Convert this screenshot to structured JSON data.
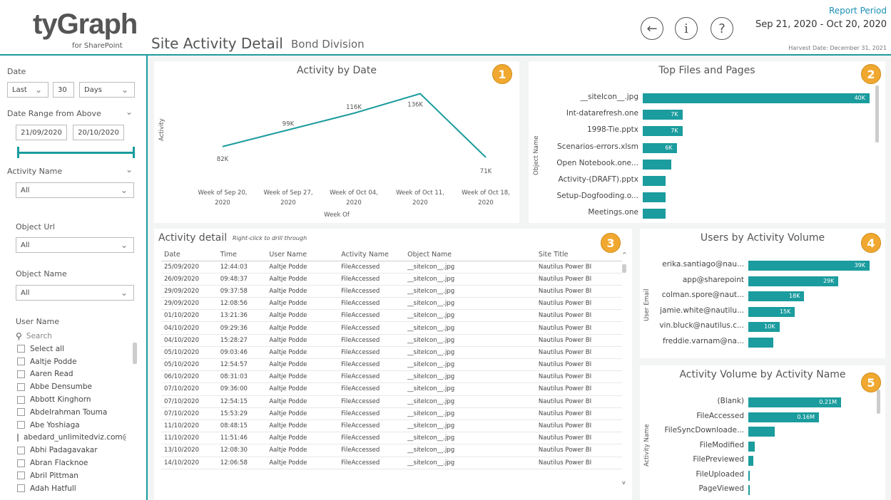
{
  "header": {
    "logo_main": "tyGraph",
    "logo_sub": "for SharePoint",
    "title": "Site Activity Detail",
    "subtitle": "Bond Division",
    "report_period_label": "Report Period",
    "report_period": "Sep 21, 2020 - Oct 20, 2020",
    "harvest_date": "Harvest Date: December 31, 2021",
    "nav": {
      "back": "←",
      "info": "i",
      "help": "?"
    }
  },
  "filters": {
    "date_label": "Date",
    "date_mode": "Last",
    "date_count": "30",
    "date_unit": "Days",
    "date_range_label": "Date Range from Above",
    "date_start": "21/09/2020",
    "date_end": "20/10/2020",
    "activity_name_label": "Activity Name",
    "activity_name_value": "All",
    "object_url_label": "Object Url",
    "object_url_value": "All",
    "object_name_label": "Object Name",
    "object_name_value": "All",
    "user_name_label": "User Name",
    "search_placeholder": "Search",
    "users": [
      "Select all",
      "Aaltje Podde",
      "Aaren Read",
      "Abbe Densumbe",
      "Abbott Kinghorn",
      "Abdelrahman Touma",
      "Abe Yoshiaga",
      "abedard_unlimitedviz.com@...",
      "Abhi Padagavakar",
      "Abran Flacknoe",
      "Abril Pittman",
      "Adah Hatfull"
    ]
  },
  "colors": {
    "accent": "#1b9c9e",
    "badge": "#f0a830"
  },
  "activity_by_date": {
    "title": "Activity by Date",
    "badge": "1",
    "chart_data": {
      "type": "line",
      "title": "Activity by Date",
      "xlabel": "Week Of",
      "ylabel": "Activity",
      "categories": [
        "Week of Sep 20, 2020",
        "Week of Sep 27, 2020",
        "Week of Oct 04, 2020",
        "Week of Oct 11, 2020",
        "Week of Oct 18, 2020"
      ],
      "cat_lines": [
        [
          "Week of Sep 20,",
          "2020"
        ],
        [
          "Week of Sep 27,",
          "2020"
        ],
        [
          "Week of Oct 04,",
          "2020"
        ],
        [
          "Week of Oct 11,",
          "2020"
        ],
        [
          "Week of Oct 18,",
          "2020"
        ]
      ],
      "values": [
        82000,
        99000,
        116000,
        136000,
        71000
      ],
      "labels": [
        "82K",
        "99K",
        "116K",
        "136K",
        "71K"
      ]
    }
  },
  "top_files": {
    "title": "Top Files and Pages",
    "badge": "2",
    "chart_data": {
      "type": "bar",
      "title": "Top Files and Pages",
      "ylabel": "Object Name",
      "categories": [
        "__siteIcon__.jpg",
        "Int-datarefresh.one",
        "1998-Tie.pptx",
        "Scenarios-errors.xlsm",
        "Open Notebook.one...",
        "Activity-(DRAFT).pptx",
        "Setup-Dogfooding.o...",
        "Meetings.one"
      ],
      "values": [
        40000,
        7000,
        7000,
        6000,
        5000,
        4000,
        4000,
        4000
      ],
      "labels": [
        "40K",
        "7K",
        "7K",
        "6K",
        "5K",
        "4K",
        "4K",
        "4K"
      ]
    }
  },
  "activity_detail": {
    "title": "Activity detail",
    "hint": "Right-click to drill through",
    "badge": "3",
    "columns": [
      "Date",
      "Time",
      "User Name",
      "Activity Name",
      "Object Name",
      "Site Title"
    ],
    "rows": [
      [
        "25/09/2020",
        "12:44:03",
        "Aaltje Podde",
        "FileAccessed",
        "__siteIcon__.jpg",
        "Nautilus Power BI"
      ],
      [
        "26/09/2020",
        "09:48:37",
        "Aaltje Podde",
        "FileAccessed",
        "__siteIcon__.jpg",
        "Nautilus Power BI"
      ],
      [
        "29/09/2020",
        "09:37:58",
        "Aaltje Podde",
        "FileAccessed",
        "__siteIcon__.jpg",
        "Nautilus Power BI"
      ],
      [
        "29/09/2020",
        "12:08:56",
        "Aaltje Podde",
        "FileAccessed",
        "__siteIcon__.jpg",
        "Nautilus Power BI"
      ],
      [
        "01/10/2020",
        "13:21:36",
        "Aaltje Podde",
        "FileAccessed",
        "__siteIcon__.jpg",
        "Nautilus Power BI"
      ],
      [
        "04/10/2020",
        "09:29:36",
        "Aaltje Podde",
        "FileAccessed",
        "__siteIcon__.jpg",
        "Nautilus Power BI"
      ],
      [
        "04/10/2020",
        "15:28:27",
        "Aaltje Podde",
        "FileAccessed",
        "__siteIcon__.jpg",
        "Nautilus Power BI"
      ],
      [
        "05/10/2020",
        "09:03:46",
        "Aaltje Podde",
        "FileAccessed",
        "__siteIcon__.jpg",
        "Nautilus Power BI"
      ],
      [
        "05/10/2020",
        "12:54:57",
        "Aaltje Podde",
        "FileAccessed",
        "__siteIcon__.jpg",
        "Nautilus Power BI"
      ],
      [
        "06/10/2020",
        "08:31:03",
        "Aaltje Podde",
        "FileAccessed",
        "__siteIcon__.jpg",
        "Nautilus Power BI"
      ],
      [
        "07/10/2020",
        "09:36:00",
        "Aaltje Podde",
        "FileAccessed",
        "__siteIcon__.jpg",
        "Nautilus Power BI"
      ],
      [
        "07/10/2020",
        "12:54:15",
        "Aaltje Podde",
        "FileAccessed",
        "__siteIcon__.jpg",
        "Nautilus Power BI"
      ],
      [
        "07/10/2020",
        "15:53:29",
        "Aaltje Podde",
        "FileAccessed",
        "__siteIcon__.jpg",
        "Nautilus Power BI"
      ],
      [
        "11/10/2020",
        "08:48:15",
        "Aaltje Podde",
        "FileAccessed",
        "__siteIcon__.jpg",
        "Nautilus Power BI"
      ],
      [
        "11/10/2020",
        "11:51:46",
        "Aaltje Podde",
        "FileAccessed",
        "__siteIcon__.jpg",
        "Nautilus Power BI"
      ],
      [
        "13/10/2020",
        "12:08:30",
        "Aaltje Podde",
        "FileAccessed",
        "__siteIcon__.jpg",
        "Nautilus Power BI"
      ],
      [
        "14/10/2020",
        "12:06:58",
        "Aaltje Podde",
        "FileAccessed",
        "__siteIcon__.jpg",
        "Nautilus Power BI"
      ]
    ]
  },
  "users_by_volume": {
    "title": "Users by Activity Volume",
    "badge": "4",
    "chart_data": {
      "type": "bar",
      "title": "Users by Activity Volume",
      "ylabel": "User Email",
      "categories": [
        "erika.santiago@nau...",
        "app@sharepoint",
        "colman.spore@naut...",
        "jamie.white@nautilu...",
        "vin.bluck@nautilus.c...",
        "freddie.varnam@na..."
      ],
      "values": [
        39000,
        29000,
        18000,
        15000,
        10000,
        8000
      ],
      "labels": [
        "39K",
        "29K",
        "18K",
        "15K",
        "10K",
        "8K"
      ]
    }
  },
  "volume_by_activity": {
    "title": "Activity Volume by Activity Name",
    "badge": "5",
    "chart_data": {
      "type": "bar",
      "title": "Activity Volume by Activity Name",
      "ylabel": "Activity Name",
      "categories": [
        "(Blank)",
        "FileAccessed",
        "FileSyncDownloade...",
        "FileModified",
        "FilePreviewed",
        "FileUploaded",
        "PageViewed"
      ],
      "values": [
        210000,
        160000,
        60000,
        15000,
        11000,
        4000,
        2500
      ],
      "labels": [
        "0.21M",
        "0.16M",
        "0.06M",
        "",
        "",
        "",
        ""
      ]
    }
  }
}
